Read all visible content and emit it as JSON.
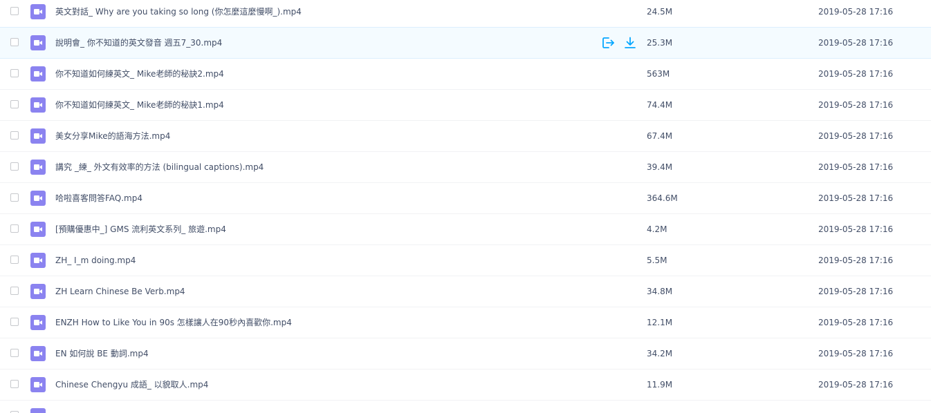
{
  "colors": {
    "video_icon": "#8b83f0",
    "action_icon": "#06a7ff",
    "hover_row": "#f4fbff",
    "text": "#424e67"
  },
  "hover_actions": {
    "share_icon": "share-icon",
    "download_icon": "download-icon"
  },
  "files": [
    {
      "name": "英文對話_ Why are you taking so long (你怎麼這麼慢啊_).mp4",
      "size": "24.5M",
      "date": "2019-05-28 17:16",
      "icon": "video-file-icon"
    },
    {
      "name": "說明會_ 你不知道的英文發音 週五7_30.mp4",
      "size": "25.3M",
      "date": "2019-05-28 17:16",
      "icon": "video-file-icon",
      "hovered": true
    },
    {
      "name": "你不知道如何練英文_ Mike老師的秘訣2.mp4",
      "size": "563M",
      "date": "2019-05-28 17:16",
      "icon": "video-file-icon"
    },
    {
      "name": "你不知道如何練英文_ Mike老師的秘訣1.mp4",
      "size": "74.4M",
      "date": "2019-05-28 17:16",
      "icon": "video-file-icon"
    },
    {
      "name": "美女分享Mike的語海方法.mp4",
      "size": "67.4M",
      "date": "2019-05-28 17:16",
      "icon": "video-file-icon"
    },
    {
      "name": "講究 _練_ 外文有效率的方法 (bilingual captions).mp4",
      "size": "39.4M",
      "date": "2019-05-28 17:16",
      "icon": "video-file-icon"
    },
    {
      "name": "哈啦喜客問答FAQ.mp4",
      "size": "364.6M",
      "date": "2019-05-28 17:16",
      "icon": "video-file-icon"
    },
    {
      "name": "[預購優惠中_] GMS 流利英文系列_ 旅遊.mp4",
      "size": "4.2M",
      "date": "2019-05-28 17:16",
      "icon": "video-file-icon"
    },
    {
      "name": "ZH_ I_m doing.mp4",
      "size": "5.5M",
      "date": "2019-05-28 17:16",
      "icon": "video-file-icon"
    },
    {
      "name": "ZH Learn Chinese Be Verb.mp4",
      "size": "34.8M",
      "date": "2019-05-28 17:16",
      "icon": "video-file-icon"
    },
    {
      "name": "ENZH How to Like You in 90s 怎樣讓人在90秒內喜歡你.mp4",
      "size": "12.1M",
      "date": "2019-05-28 17:16",
      "icon": "video-file-icon"
    },
    {
      "name": "EN 如何說 BE 動詞.mp4",
      "size": "34.2M",
      "date": "2019-05-28 17:16",
      "icon": "video-file-icon"
    },
    {
      "name": "Chinese Chengyu 成語_ 以貌取人.mp4",
      "size": "11.9M",
      "date": "2019-05-28 17:16",
      "icon": "video-file-icon"
    },
    {
      "name": "",
      "size": "",
      "date": "",
      "icon": "video-file-icon"
    }
  ]
}
